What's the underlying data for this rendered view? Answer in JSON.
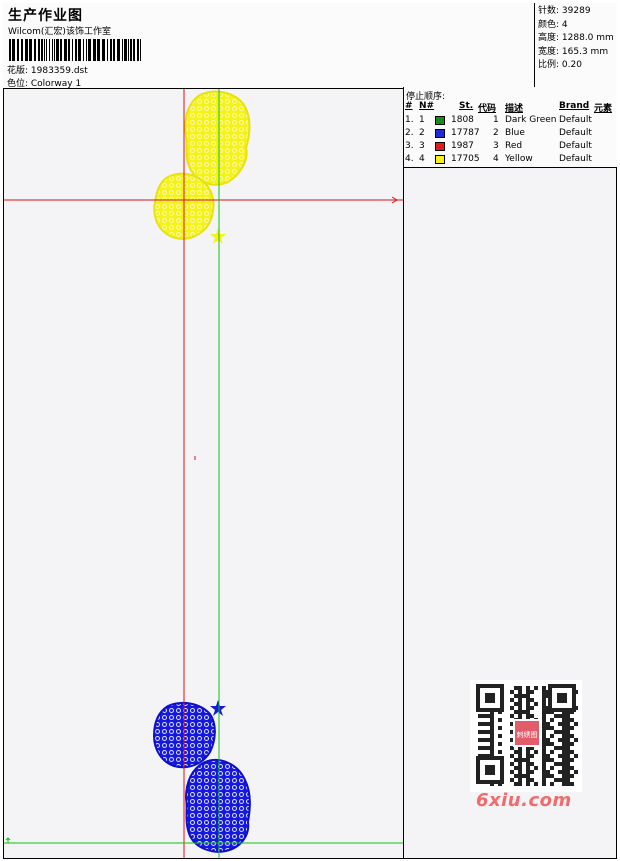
{
  "header": {
    "title": "生产作业图",
    "subtitle": "Wilcom(汇宏)该饰工作室",
    "design_line": "花版:  1983359.dst",
    "colorway_line": "色位:  Colorway 1"
  },
  "stats": [
    {
      "label": "针数:",
      "value": "39289"
    },
    {
      "label": "颜色:",
      "value": "4"
    },
    {
      "label": "高度:",
      "value": "1288.0 mm"
    },
    {
      "label": "宽度:",
      "value": "165.3 mm"
    },
    {
      "label": "比例:",
      "value": "0.20"
    }
  ],
  "stop_sequence": {
    "title": "停止顺序:",
    "headers": {
      "index": "#",
      "number": "N#",
      "stitches": "St.",
      "code": "代码",
      "description": "描述",
      "brand": "Brand",
      "element": "元素"
    },
    "rows": [
      {
        "index": "1.",
        "number": "1",
        "color": "#1a8a1a",
        "stitches": "1808",
        "code": "1",
        "description": "Dark Green",
        "brand": "Default"
      },
      {
        "index": "2.",
        "number": "2",
        "color": "#1f2bd8",
        "stitches": "17787",
        "code": "2",
        "description": "Blue",
        "brand": "Default"
      },
      {
        "index": "3.",
        "number": "3",
        "color": "#e41b1b",
        "stitches": "1987",
        "code": "3",
        "description": "Red",
        "brand": "Default"
      },
      {
        "index": "4.",
        "number": "4",
        "color": "#f7f31a",
        "stitches": "17705",
        "code": "4",
        "description": "Yellow",
        "brand": "Default"
      }
    ]
  },
  "watermark": {
    "text": "6xiu.com",
    "qr_badge": "刺绣图"
  },
  "colors": {
    "red_guide": "#e01010",
    "green_guide": "#10c010",
    "yellow": "#f5f21a",
    "blue": "#1418e0"
  }
}
